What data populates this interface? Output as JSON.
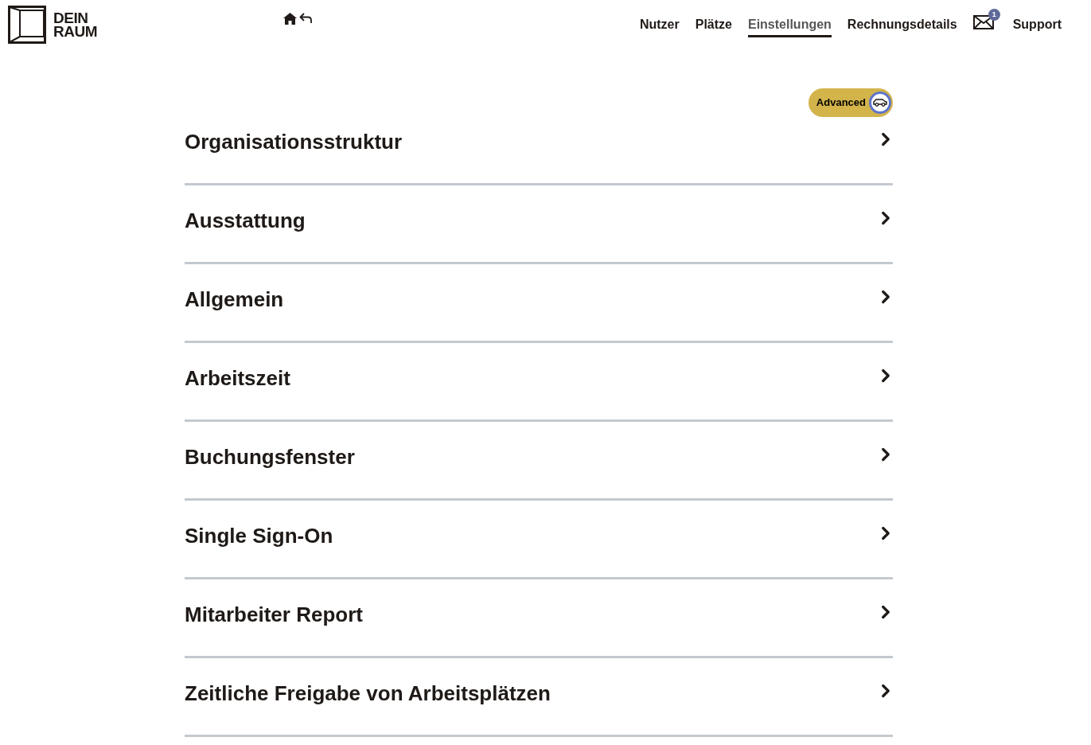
{
  "logo": {
    "lines": [
      "DEIN",
      "RAUM"
    ]
  },
  "nav": [
    {
      "label": "Nutzer",
      "selected": false
    },
    {
      "label": "Plätze",
      "selected": false
    },
    {
      "label": "Einstellungen",
      "selected": true
    },
    {
      "label": "Rechnungsdetails",
      "selected": false
    }
  ],
  "messages": {
    "count": "1"
  },
  "support": "Support",
  "mode_toggle": {
    "label": "Advanced"
  },
  "sections": [
    {
      "title": "Organisationsstruktur"
    },
    {
      "title": "Ausstattung"
    },
    {
      "title": "Allgemein"
    },
    {
      "title": "Arbeitszeit"
    },
    {
      "title": "Buchungsfenster"
    },
    {
      "title": "Single Sign-On"
    },
    {
      "title": "Mitarbeiter Report"
    },
    {
      "title": "Zeitliche Freigabe von Arbeitsplätzen"
    }
  ]
}
